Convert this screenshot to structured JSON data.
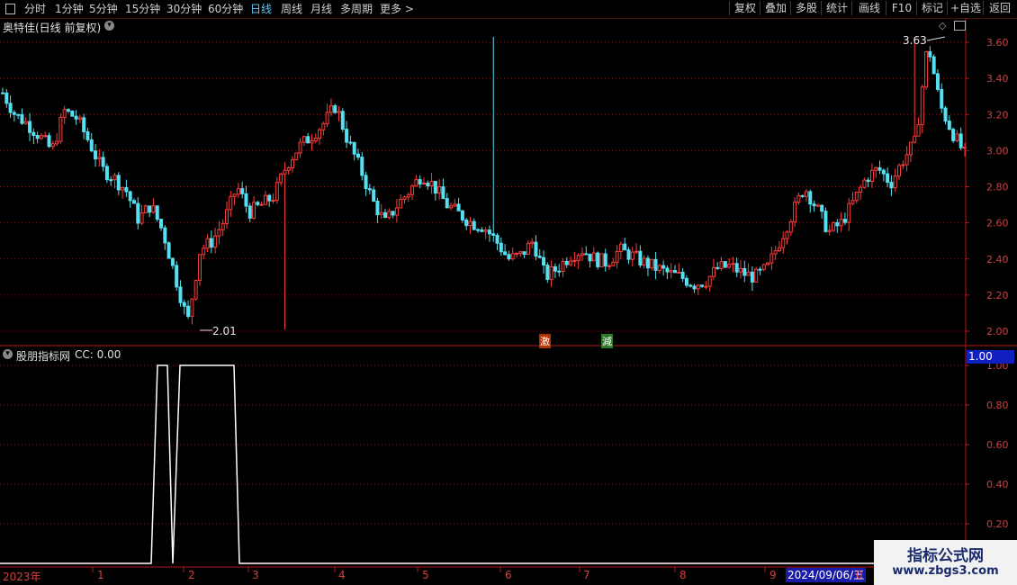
{
  "toolbar": {
    "periods": [
      "分时",
      "1分钟",
      "5分钟",
      "15分钟",
      "30分钟",
      "60分钟",
      "日线",
      "周线",
      "月线",
      "多周期",
      "更多 >"
    ],
    "active": "日线",
    "right": [
      "复权",
      "叠加",
      "多股",
      "统计",
      "画线",
      "F10",
      "标记",
      "+自选",
      "返回"
    ]
  },
  "main": {
    "title": "奥特佳(日线 前复权)",
    "price_ticks": [
      "3.60",
      "3.40",
      "3.20",
      "3.00",
      "2.80",
      "2.60",
      "2.40",
      "2.20",
      "2.00"
    ],
    "high_label": "3.63",
    "low_label": "2.01",
    "markers": [
      "激",
      "減"
    ]
  },
  "indicator": {
    "title": "股朋指标网",
    "cc_label": "CC: 0.00",
    "current_value": "1.00",
    "ticks": [
      "1.00",
      "0.80",
      "0.60",
      "0.40",
      "0.20"
    ]
  },
  "time_axis": {
    "labels": [
      "2023年",
      "1",
      "2",
      "3",
      "4",
      "5",
      "6",
      "7",
      "8",
      "9",
      "0"
    ],
    "cursor_date": "2024/09/06/五"
  },
  "watermark": {
    "line1": "指标公式网",
    "line2": "www.zbgs3.com"
  },
  "colors": {
    "up": "#ff3b3b",
    "down": "#54e0f0",
    "grid": "#7a1a1a",
    "axis": "#b01818",
    "indicator": "#ffffff"
  },
  "chart_data": [
    {
      "type": "candlestick",
      "title": "奥特佳(日线 前复权)",
      "ylim": [
        1.95,
        3.7
      ],
      "closes_approx": [
        3.32,
        3.2,
        3.15,
        3.08,
        3.0,
        3.22,
        3.18,
        3.05,
        2.9,
        2.85,
        2.78,
        2.62,
        2.7,
        2.55,
        2.3,
        2.05,
        2.45,
        2.5,
        2.62,
        2.8,
        2.66,
        2.7,
        2.75,
        2.92,
        3.02,
        3.08,
        3.15,
        3.25,
        3.05,
        2.9,
        2.72,
        2.6,
        2.7,
        2.78,
        2.87,
        2.8,
        2.7,
        2.65,
        2.6,
        2.58,
        2.5,
        2.4,
        2.42,
        2.5,
        2.3,
        2.35,
        2.42,
        2.45,
        2.4,
        2.38,
        2.45,
        2.42,
        2.38,
        2.35,
        2.32,
        2.3,
        2.26,
        2.28,
        2.35,
        2.36,
        2.32,
        2.3,
        2.35,
        2.5,
        2.65,
        2.8,
        2.68,
        2.55,
        2.6,
        2.72,
        2.85,
        2.9,
        2.82,
        2.95,
        3.05,
        3.6,
        3.25,
        3.1,
        2.98
      ],
      "high": 3.63,
      "low": 2.01
    },
    {
      "type": "line",
      "title": "股朋指标网",
      "series": [
        {
          "name": "CC",
          "values": [
            0,
            0,
            1,
            1,
            0,
            1,
            1,
            1,
            0,
            0,
            0
          ]
        }
      ],
      "ylim": [
        0,
        1
      ]
    }
  ]
}
